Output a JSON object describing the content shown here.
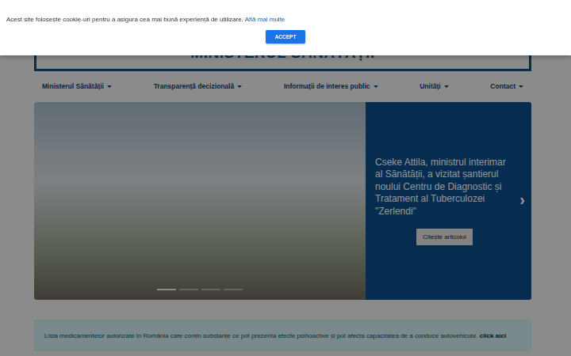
{
  "cookie_banner": {
    "text": "Acest site folosește cookie-uri pentru a asigura cea mai bună experiență de utilizare.",
    "link": "Află mai multe",
    "button": "ACCEPT"
  },
  "header": {
    "title": "MINISTERUL SĂNĂTĂȚII"
  },
  "nav": [
    {
      "label": "Ministerul Sănătății"
    },
    {
      "label": "Transparență decizională"
    },
    {
      "label": "Informații de interes public"
    },
    {
      "label": "Unități"
    },
    {
      "label": "Contact"
    }
  ],
  "carousel": {
    "caption": "Cseke Attila, ministrul interimar al Sănătății, a vizitat șantierul noului Centru de Diagnostic și Tratament al Tuberculozei \"Zerlendi\"",
    "button": "Citește articolul",
    "next": "›",
    "indicators": [
      {
        "selected": true
      },
      {
        "selected": false
      },
      {
        "selected": false
      },
      {
        "selected": false
      }
    ]
  },
  "notice": {
    "text": "Lista medicamentelor autorizate în România care conțin substanțe ce pot prezenta efecte psihoactive și pot afecta capacitatea de a conduce autovehicule.",
    "link": "click aici"
  }
}
